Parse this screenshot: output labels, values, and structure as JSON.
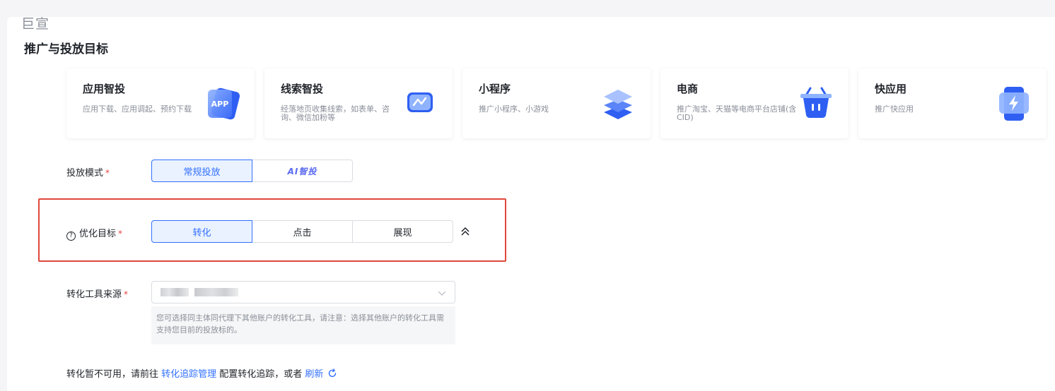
{
  "brand": "巨宣",
  "section_title": "推广与投放目标",
  "cards": [
    {
      "title": "应用智投",
      "desc": "应用下载、应用调起、预约下载",
      "icon": "app-icon",
      "icon_text": "APP"
    },
    {
      "title": "线索智投",
      "desc": "经落地页收集线索，如表单、咨询、微信加粉等",
      "icon": "chat-icon"
    },
    {
      "title": "小程序",
      "desc": "推广小程序、小游戏",
      "icon": "layers-icon"
    },
    {
      "title": "电商",
      "desc": "推广淘宝、天猫等电商平台店铺(含CID)",
      "icon": "basket-icon"
    },
    {
      "title": "快应用",
      "desc": "推广快应用",
      "icon": "lightning-phone-icon"
    }
  ],
  "delivery_mode": {
    "label": "投放模式",
    "required_mark": "*",
    "options": [
      "常规投放",
      "AI智投"
    ],
    "selected": "常规投放"
  },
  "optimization_goal": {
    "label": "优化目标",
    "required_mark": "*",
    "help_glyph": "?",
    "options": [
      "转化",
      "点击",
      "展现"
    ],
    "selected": "转化"
  },
  "conversion_tool": {
    "label": "转化工具来源",
    "required_mark": "*",
    "hint": "您可选择同主体同代理下其他账户的转化工具，请注意：选择其他账户的转化工具需支持您目前的投放标的。"
  },
  "footer": {
    "prefix": "转化暂不可用，请前往 ",
    "link_manage": "转化追踪管理",
    "middle": " 配置转化追踪，或者 ",
    "link_refresh": "刷新"
  },
  "colors": {
    "accent": "#3370ff",
    "highlight_border": "#e0473b",
    "required": "#e54545"
  }
}
